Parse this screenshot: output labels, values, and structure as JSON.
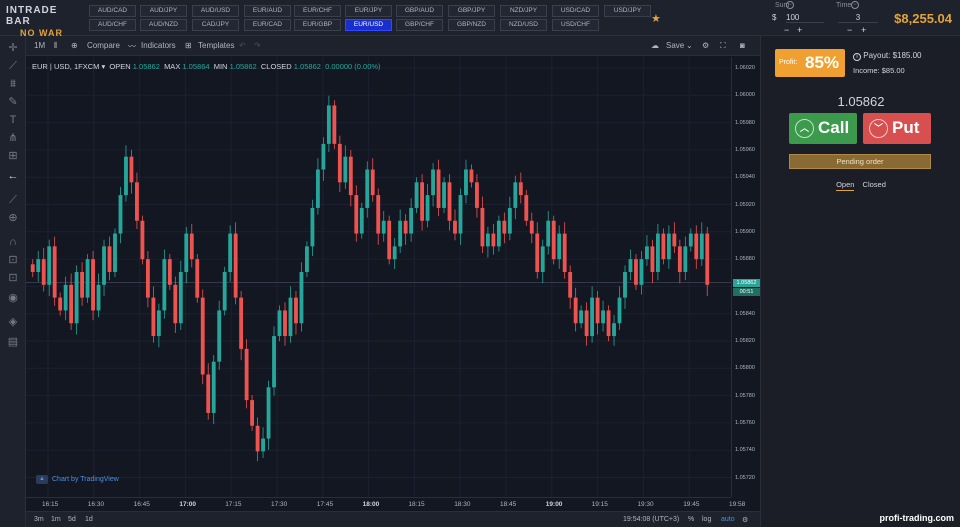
{
  "brand": {
    "name": "INTRADE BAR",
    "tagline": "NO WAR"
  },
  "pairs_row1": [
    "AUD/CAD",
    "AUD/JPY",
    "AUD/USD",
    "EUR/AUD",
    "EUR/CHF",
    "EUR/JPY",
    "GBP/AUD",
    "GBP/JPY",
    "NZD/JPY",
    "USD/CAD",
    "USD/JPY"
  ],
  "pairs_row2": [
    "AUD/CHF",
    "AUD/NZD",
    "CAD/JPY",
    "EUR/CAD",
    "EUR/GBP",
    "EUR/USD",
    "GBP/CHF",
    "GBP/NZD",
    "NZD/USD",
    "USD/CHF"
  ],
  "active_pair": "EUR/USD",
  "sum": {
    "label": "Sum",
    "currency": "$",
    "value": "100"
  },
  "time": {
    "label": "Time",
    "value": "3"
  },
  "balance": "$8,255.04",
  "toolbar": {
    "interval": "1M",
    "compare": "Compare",
    "indicators": "Indicators",
    "templates": "Templates",
    "save": "Save"
  },
  "legend": {
    "symbol": "EUR | USD, 1FXCM",
    "open_label": "OPEN",
    "open": "1.05862",
    "max_label": "MAX",
    "max": "1.05864",
    "min_label": "MIN",
    "min": "1.05862",
    "closed_label": "CLOSED",
    "closed": "1.05862",
    "change": "0.00000 (0.00%)"
  },
  "tv_badge": "Chart by TradingView",
  "price_ticks": [
    "1.06020",
    "1.06000",
    "1.05980",
    "1.05960",
    "1.05940",
    "1.05920",
    "1.05900",
    "1.05880",
    "1.05860",
    "1.05840",
    "1.05820",
    "1.05800",
    "1.05780",
    "1.05760",
    "1.05740",
    "1.05720"
  ],
  "current_price": "1.05862",
  "countdown": "00:51",
  "time_ticks": [
    {
      "t": "16:15",
      "b": false
    },
    {
      "t": "16:30",
      "b": false
    },
    {
      "t": "16:45",
      "b": false
    },
    {
      "t": "17:00",
      "b": true
    },
    {
      "t": "17:15",
      "b": false
    },
    {
      "t": "17:30",
      "b": false
    },
    {
      "t": "17:45",
      "b": false
    },
    {
      "t": "18:00",
      "b": true
    },
    {
      "t": "18:15",
      "b": false
    },
    {
      "t": "18:30",
      "b": false
    },
    {
      "t": "18:45",
      "b": false
    },
    {
      "t": "19:00",
      "b": true
    },
    {
      "t": "19:15",
      "b": false
    },
    {
      "t": "19:30",
      "b": false
    },
    {
      "t": "19:45",
      "b": false
    },
    {
      "t": "19:58",
      "b": false
    }
  ],
  "ranges": [
    "3m",
    "1m",
    "5d",
    "1d"
  ],
  "clock": "19:54:08 (UTC+3)",
  "scale_opts": [
    "%",
    "log",
    "auto"
  ],
  "panel": {
    "profit_label": "Profit:",
    "profit_pct": "85%",
    "payout": "Payout: $185.00",
    "income": "Income: $85.00",
    "quote": "1.05862",
    "call": "Call",
    "put": "Put",
    "pending": "Pending order",
    "tab_open": "Open",
    "tab_closed": "Closed"
  },
  "watermark": "profi-trading.com",
  "colors": {
    "up": "#26a69a",
    "down": "#ef5350",
    "accent": "#e2a33b"
  },
  "chart_data": {
    "type": "candlestick",
    "ylim": [
      1.0571,
      1.0603
    ],
    "closes": [
      1.0587,
      1.0588,
      1.0586,
      1.0589,
      1.0585,
      1.0584,
      1.0586,
      1.0583,
      1.0587,
      1.0585,
      1.0588,
      1.0584,
      1.0586,
      1.0589,
      1.0587,
      1.059,
      1.0593,
      1.0596,
      1.0594,
      1.0591,
      1.0588,
      1.0585,
      1.0582,
      1.0584,
      1.0588,
      1.0586,
      1.0583,
      1.0587,
      1.059,
      1.0588,
      1.0585,
      1.0579,
      1.0576,
      1.058,
      1.0584,
      1.0587,
      1.059,
      1.0585,
      1.0581,
      1.0577,
      1.0575,
      1.0573,
      1.0574,
      1.0578,
      1.0582,
      1.0584,
      1.0582,
      1.0585,
      1.0583,
      1.0587,
      1.0589,
      1.0592,
      1.0595,
      1.0597,
      1.06,
      1.0597,
      1.0594,
      1.0596,
      1.0593,
      1.059,
      1.0592,
      1.0595,
      1.0593,
      1.059,
      1.0591,
      1.0588,
      1.0589,
      1.0591,
      1.059,
      1.0592,
      1.0594,
      1.0591,
      1.0593,
      1.0595,
      1.0592,
      1.0594,
      1.0591,
      1.059,
      1.0593,
      1.0595,
      1.0594,
      1.0592,
      1.0589,
      1.059,
      1.0589,
      1.0591,
      1.059,
      1.0592,
      1.0594,
      1.0593,
      1.0591,
      1.059,
      1.0587,
      1.0589,
      1.0591,
      1.0588,
      1.059,
      1.0587,
      1.0585,
      1.0583,
      1.0584,
      1.0582,
      1.0585,
      1.0583,
      1.0584,
      1.0582,
      1.0583,
      1.0585,
      1.0587,
      1.0588,
      1.0586,
      1.0588,
      1.0589,
      1.0587,
      1.059,
      1.0588,
      1.059,
      1.0589,
      1.0587,
      1.0589,
      1.059,
      1.0588,
      1.059,
      1.0586
    ]
  }
}
